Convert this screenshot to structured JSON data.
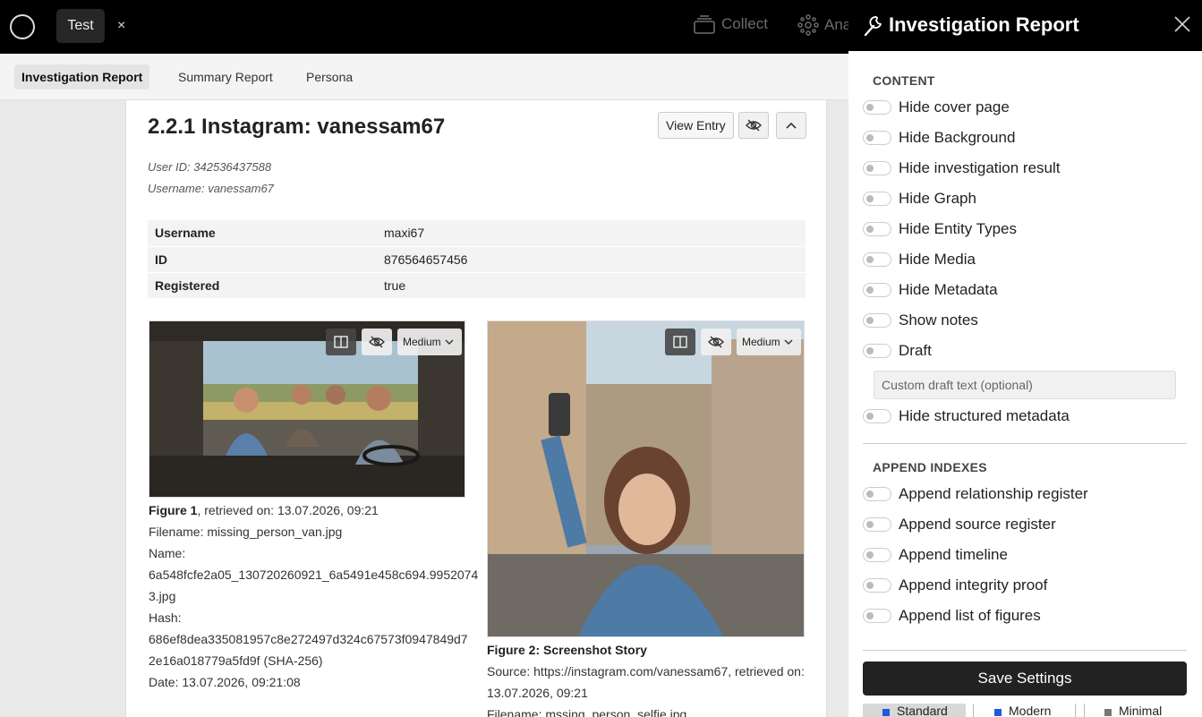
{
  "topbar": {
    "tab_label": "Test",
    "tab_close": "×",
    "nav_collect": "Collect",
    "nav_analyze": "Ana"
  },
  "subnav": {
    "tabs": [
      "Investigation Report",
      "Summary Report",
      "Persona"
    ],
    "active": "Investigation Report"
  },
  "entry": {
    "title": "2.2.1 Instagram: vanessam67",
    "view_entry_label": "View Entry",
    "user_id": "User ID: 342536437588",
    "username": "Username: vanessam67",
    "attributes": [
      {
        "key": "Username",
        "value": "maxi67"
      },
      {
        "key": "ID",
        "value": "876564657456"
      },
      {
        "key": "Registered",
        "value": "true"
      }
    ],
    "figures": [
      {
        "size_option": "Medium",
        "caption_bold": "Figure 1",
        "caption_rest": ", retrieved on: 13.07.2026, 09:21",
        "lines": [
          "Filename: missing_person_van.jpg",
          "Name:",
          "6a548fcfe2a05_130720260921_6a5491e458c694.9952074",
          "3.jpg",
          "Hash:",
          "686ef8dea335081957c8e272497d324c67573f0947849d7",
          "2e16a018779a5fd9f (SHA-256)",
          "Date: 13.07.2026, 09:21:08"
        ]
      },
      {
        "size_option": "Medium",
        "caption_bold": "Figure 2: Screenshot Story",
        "caption_rest": "",
        "lines": [
          "Source: https://instagram.com/vanessam67, retrieved on:",
          "13.07.2026, 09:21",
          "Filename: mssing_person_selfie.jpg"
        ]
      }
    ]
  },
  "panel": {
    "title": "Investigation Report",
    "content_label": "CONTENT",
    "content_toggles": [
      "Hide cover page",
      "Hide Background",
      "Hide investigation result",
      "Hide Graph",
      "Hide Entity Types",
      "Hide Media",
      "Hide Metadata",
      "Show notes",
      "Draft"
    ],
    "draft_placeholder": "Custom draft text (optional)",
    "structured_toggle": "Hide structured metadata",
    "append_label": "APPEND INDEXES",
    "append_toggles": [
      "Append relationship register",
      "Append source register",
      "Append timeline",
      "Append integrity proof",
      "Append list of figures"
    ],
    "save_label": "Save Settings",
    "styles": [
      {
        "label": "Standard",
        "color": "#1e5bd6",
        "selected": true
      },
      {
        "label": "Modern",
        "color": "#1e5bd6",
        "selected": false
      },
      {
        "label": "Minimal",
        "color": "#777777",
        "selected": false
      }
    ]
  }
}
